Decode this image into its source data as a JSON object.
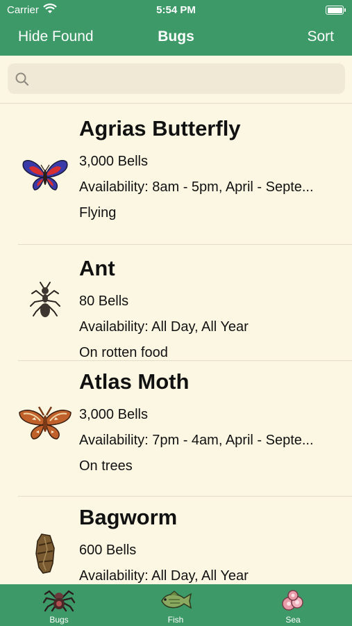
{
  "status": {
    "carrier": "Carrier",
    "time": "5:54 PM"
  },
  "nav": {
    "left": "Hide Found",
    "title": "Bugs",
    "right": "Sort"
  },
  "search": {
    "placeholder": "",
    "value": ""
  },
  "bugs": [
    {
      "name": "Agrias Butterfly",
      "price": "3,000 Bells",
      "availability": "Availability: 8am - 5pm, April - Septe...",
      "location": "Flying",
      "icon": "agrias-butterfly-icon"
    },
    {
      "name": "Ant",
      "price": "80 Bells",
      "availability": "Availability: All Day, All Year",
      "location": "On rotten food",
      "icon": "ant-icon"
    },
    {
      "name": "Atlas Moth",
      "price": "3,000 Bells",
      "availability": "Availability: 7pm - 4am, April - Septe...",
      "location": "On trees",
      "icon": "atlas-moth-icon"
    },
    {
      "name": "Bagworm",
      "price": "600 Bells",
      "availability": "Availability: All Day, All Year",
      "location": "",
      "icon": "bagworm-icon"
    }
  ],
  "tabs": [
    {
      "label": "Bugs",
      "icon": "tarantula-icon"
    },
    {
      "label": "Fish",
      "icon": "fish-icon"
    },
    {
      "label": "Sea",
      "icon": "sea-creature-icon"
    }
  ],
  "colors": {
    "accent": "#3d9a68",
    "background": "#fcf7e3",
    "search": "#efe9d6"
  }
}
